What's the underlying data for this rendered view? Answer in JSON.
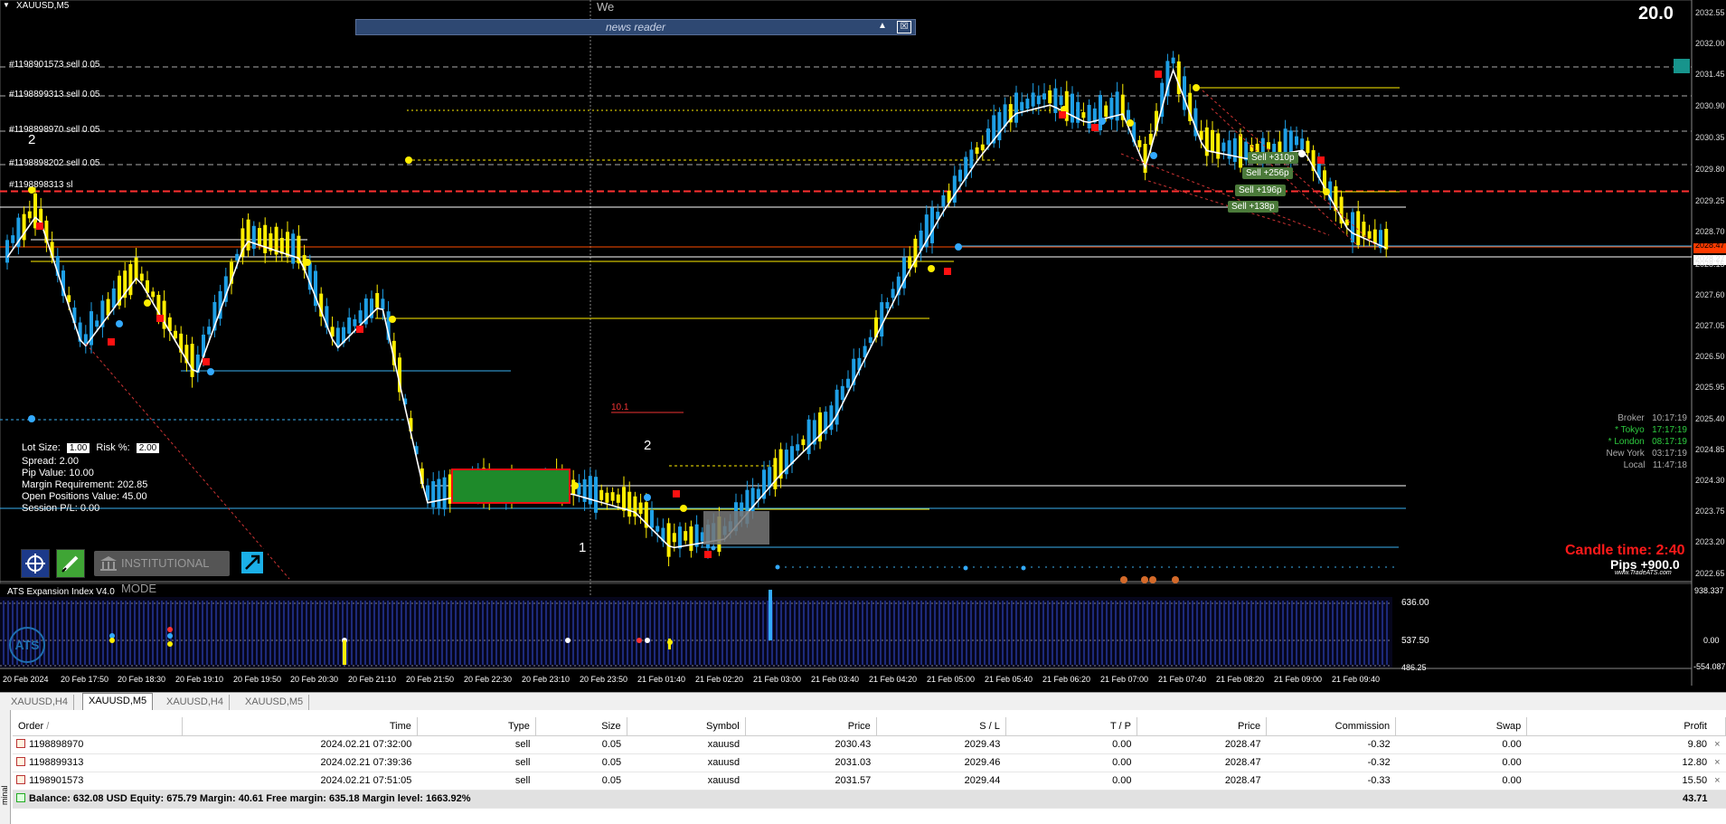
{
  "chart": {
    "symbol_label": "XAUUSD,M5",
    "period_separator_label": "We",
    "big_number": "20.0",
    "news_reader": {
      "title": "news reader",
      "collapse_icon": "▲",
      "close_icon": "☒"
    },
    "trade_lines": [
      {
        "label": "#1198901573 sell 0.05",
        "price": 2031.57
      },
      {
        "label": "#1198899313 sell 0.05",
        "price": 2031.03
      },
      {
        "label": "#1198898970 sell 0.05",
        "price": 2030.43
      },
      {
        "label": "#1198898202 sell 0.05",
        "price": 2029.82
      },
      {
        "label": "#1198898313 sl",
        "price": 2029.44
      }
    ],
    "wave_labels": [
      "2",
      "2",
      "1",
      "10.1"
    ],
    "price_axis": [
      "2032.55",
      "2032.00",
      "2031.45",
      "2030.90",
      "2030.35",
      "2029.80",
      "2029.25",
      "2028.70",
      "2028.47",
      "2028.27",
      "2028.15",
      "2027.60",
      "2027.05",
      "2026.50",
      "2025.95",
      "2025.40",
      "2024.85",
      "2024.30",
      "2023.75",
      "2023.20",
      "2022.65"
    ],
    "time_axis": [
      "20 Feb 2024",
      "20 Feb 17:50",
      "20 Feb 18:30",
      "20 Feb 19:10",
      "20 Feb 19:50",
      "20 Feb 20:30",
      "20 Feb 21:10",
      "20 Feb 21:50",
      "20 Feb 22:30",
      "20 Feb 23:10",
      "20 Feb 23:50",
      "21 Feb 01:40",
      "21 Feb 02:20",
      "21 Feb 03:00",
      "21 Feb 03:40",
      "21 Feb 04:20",
      "21 Feb 05:00",
      "21 Feb 05:40",
      "21 Feb 06:20",
      "21 Feb 07:00",
      "21 Feb 07:40",
      "21 Feb 08:20",
      "21 Feb 09:00",
      "21 Feb 09:40"
    ],
    "sell_tags": [
      "Sell +310p",
      "Sell +256p",
      "Sell +196p",
      "Sell +138p"
    ],
    "info_panel": {
      "lot_size_label": "Lot Size:",
      "lot_size_value": "1.00",
      "risk_label": "Risk %:",
      "risk_value": "2.00",
      "spread": "Spread: 2.00",
      "pip_value": "Pip Value: 10.00",
      "margin_req": "Margin Requirement: 202.85",
      "open_positions": "Open Positions Value: 45.00",
      "session_pl": "Session P/L: 0.00"
    },
    "buttons": {
      "institutional_mode": "INSTITUTIONAL MODE"
    },
    "sessions": [
      {
        "name": "Broker",
        "time": "10:17:19",
        "color": "#aaaaaa"
      },
      {
        "name": "* Tokyo",
        "time": "17:17:19",
        "color": "#2ecc40"
      },
      {
        "name": "* London",
        "time": "08:17:19",
        "color": "#2ecc40"
      },
      {
        "name": "New York",
        "time": "03:17:19",
        "color": "#aaaaaa"
      },
      {
        "name": "Local",
        "time": "11:47:18",
        "color": "#aaaaaa"
      }
    ],
    "candle_time": "Candle time:  2:40",
    "pips": "Pips +900.0",
    "site": "www.TradeATS.com"
  },
  "indicator": {
    "title": "ATS Expansion Index V4.0",
    "levels": [
      "636.00",
      "537.50",
      "486.25"
    ],
    "axis": [
      "938.337",
      "0.00",
      "-554.087"
    ],
    "logo": "ATS"
  },
  "tabs": [
    {
      "label": "XAUUSD,H4",
      "active": false
    },
    {
      "label": "XAUUSD,M5",
      "active": true
    },
    {
      "label": "XAUUSD,H4",
      "active": false
    },
    {
      "label": "XAUUSD,M5",
      "active": false
    }
  ],
  "terminal": {
    "side_label": "minal",
    "columns": [
      "Order",
      "Time",
      "Type",
      "Size",
      "Symbol",
      "Price",
      "S / L",
      "T / P",
      "Price",
      "Commission",
      "Swap",
      "Profit"
    ],
    "sort_indicator": "/",
    "rows": [
      {
        "order": "1198898970",
        "time": "2024.02.21 07:32:00",
        "type": "sell",
        "size": "0.05",
        "symbol": "xauusd",
        "price": "2030.43",
        "sl": "2029.43",
        "tp": "0.00",
        "cur_price": "2028.47",
        "commission": "-0.32",
        "swap": "0.00",
        "profit": "9.80"
      },
      {
        "order": "1198899313",
        "time": "2024.02.21 07:39:36",
        "type": "sell",
        "size": "0.05",
        "symbol": "xauusd",
        "price": "2031.03",
        "sl": "2029.46",
        "tp": "0.00",
        "cur_price": "2028.47",
        "commission": "-0.32",
        "swap": "0.00",
        "profit": "12.80"
      },
      {
        "order": "1198901573",
        "time": "2024.02.21 07:51:05",
        "type": "sell",
        "size": "0.05",
        "symbol": "xauusd",
        "price": "2031.57",
        "sl": "2029.44",
        "tp": "0.00",
        "cur_price": "2028.47",
        "commission": "-0.33",
        "swap": "0.00",
        "profit": "15.50"
      }
    ],
    "balance_line": "Balance: 632.08 USD  Equity: 675.79  Margin: 40.61  Free margin: 635.18  Margin level: 1663.92%",
    "total_profit": "43.71",
    "close_icon": "×"
  },
  "colors": {
    "bull": "#1e9fe6",
    "bear": "#ffee00",
    "sl_line": "#ff2222",
    "ma": "#ffffff"
  }
}
